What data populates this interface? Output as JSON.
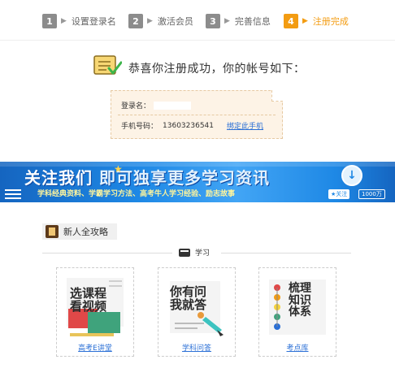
{
  "steps": [
    {
      "num": "1",
      "label": "设置登录名",
      "active": false
    },
    {
      "num": "2",
      "label": "激活会员",
      "active": false
    },
    {
      "num": "3",
      "label": "完善信息",
      "active": false
    },
    {
      "num": "4",
      "label": "注册完成",
      "active": true
    }
  ],
  "success": {
    "title": "恭喜你注册成功，你的帐号如下："
  },
  "account": {
    "login_label": "登录名：",
    "phone_label": "手机号码：",
    "phone_value": "13603236541",
    "bind_link": "绑定此手机"
  },
  "banner": {
    "headline_a": "关注我们",
    "headline_b": "即可独享更多学习资讯",
    "subline": "学科经典资料、学霸学习方法、高考牛人学习经验、励志故事",
    "follow_label": "关注",
    "follow_count": "1000万"
  },
  "guide": {
    "tag_label": "新人全攻略",
    "section_label": "学习"
  },
  "cards": [
    {
      "art_line1": "选课程",
      "art_line2": "看视频",
      "caption": "高考E讲堂"
    },
    {
      "art_line1": "你有问",
      "art_line2": "我就答",
      "caption": "学科问答"
    },
    {
      "art_line1": "梳理",
      "art_line2": "知识",
      "art_line3": "体系",
      "caption": "考点库"
    }
  ],
  "colors": {
    "accent": "#f39c12",
    "step_inactive": "#8c8c8c",
    "link": "#2a6fd6",
    "banner": "#1e88e5",
    "card_bg": "#fdf3e6"
  }
}
